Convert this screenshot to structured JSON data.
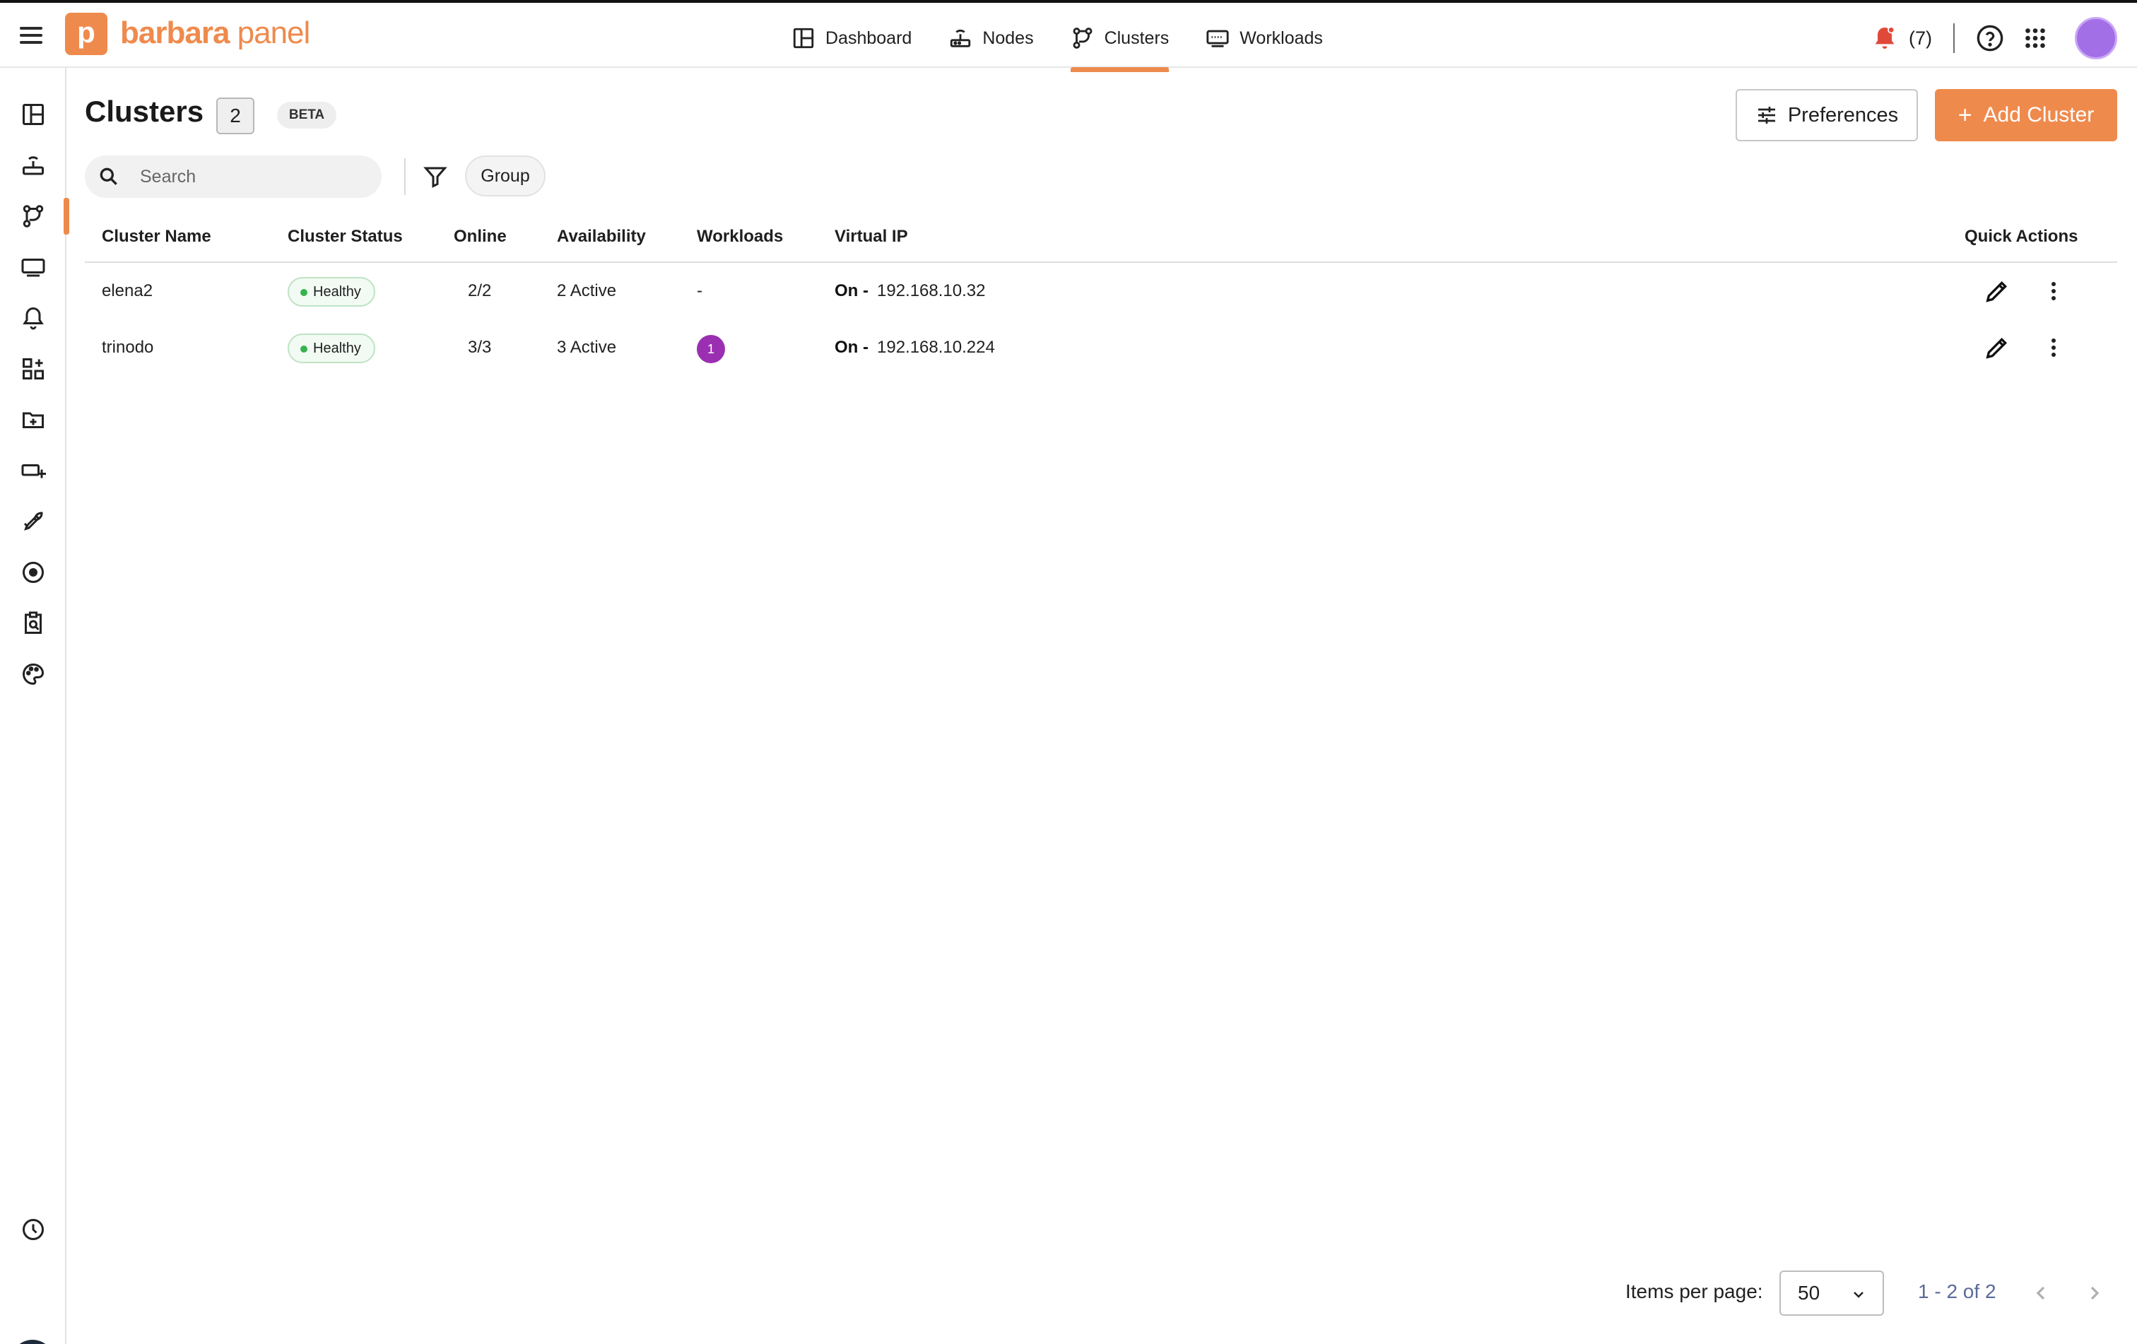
{
  "app": {
    "logo_letter": "p",
    "brand_bold": "barbara",
    "brand_light": " panel",
    "accent_color": "#ef8a4d"
  },
  "topnav": {
    "tabs": [
      {
        "label": "Dashboard",
        "icon": "dashboard-icon",
        "active": false
      },
      {
        "label": "Nodes",
        "icon": "router-icon",
        "active": false
      },
      {
        "label": "Clusters",
        "icon": "cluster-icon",
        "active": true
      },
      {
        "label": "Workloads",
        "icon": "monitor-icon",
        "active": false
      }
    ],
    "notifications_count": "(7)"
  },
  "sidebar": {
    "items": [
      {
        "icon": "dashboard-icon",
        "active": false
      },
      {
        "icon": "router-icon",
        "active": false
      },
      {
        "icon": "cluster-icon",
        "active": true
      },
      {
        "icon": "monitor-icon",
        "active": false
      },
      {
        "icon": "bell-icon",
        "active": false
      },
      {
        "icon": "apps-add-icon",
        "active": false
      },
      {
        "icon": "folder-add-icon",
        "active": false
      },
      {
        "icon": "device-add-icon",
        "active": false
      },
      {
        "icon": "rocket-icon",
        "active": false
      },
      {
        "icon": "target-icon",
        "active": false
      },
      {
        "icon": "search-document-icon",
        "active": false
      },
      {
        "icon": "palette-icon",
        "active": false
      }
    ],
    "bottom_items": [
      {
        "icon": "clock-icon"
      },
      {
        "icon": "lightbulb-icon"
      }
    ]
  },
  "page": {
    "title": "Clusters",
    "count": "2",
    "beta_label": "BETA",
    "preferences_label": "Preferences",
    "add_label": "Add Cluster",
    "add_plus": "+"
  },
  "toolbar": {
    "search_placeholder": "Search",
    "group_label": "Group"
  },
  "table": {
    "columns": [
      "Cluster Name",
      "Cluster Status",
      "Online",
      "Availability",
      "Workloads",
      "Virtual IP",
      "Quick Actions"
    ],
    "rows": [
      {
        "name": "elena2",
        "status": "Healthy",
        "online": "2/2",
        "availability": "2 Active",
        "workloads": "-",
        "workloads_badge": null,
        "vip_state": "On -",
        "vip": "192.168.10.32"
      },
      {
        "name": "trinodo",
        "status": "Healthy",
        "online": "3/3",
        "availability": "3 Active",
        "workloads": "",
        "workloads_badge": "1",
        "vip_state": "On -",
        "vip": "192.168.10.224"
      }
    ]
  },
  "pagination": {
    "items_per_page_label": "Items per page:",
    "items_per_page_value": "50",
    "range_text": "1 - 2 of 2"
  }
}
